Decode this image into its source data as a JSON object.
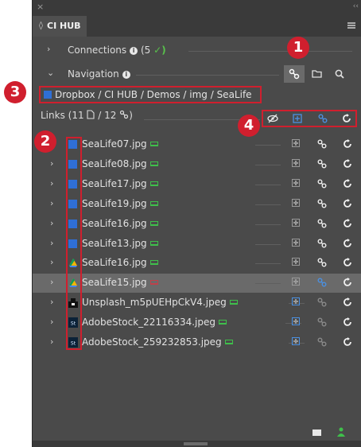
{
  "window": {
    "close_glyph": "×",
    "collapse_glyph": "‹‹"
  },
  "tab": {
    "label": "CI HUB",
    "icon": "ci-hub-icon"
  },
  "connections": {
    "label": "Connections",
    "count": "(5",
    "check": "✓)"
  },
  "navigation": {
    "label": "Navigation"
  },
  "path": {
    "text": "Dropbox / CI HUB / Demos / img / SeaLife"
  },
  "links": {
    "label": "Links (11",
    "sep": "/ 12"
  },
  "files": [
    {
      "name": "SeaLife07.jpg",
      "icon": "dropbox-icon",
      "status": "ok",
      "selected": false
    },
    {
      "name": "SeaLife08.jpg",
      "icon": "dropbox-icon",
      "status": "ok",
      "selected": false
    },
    {
      "name": "SeaLife17.jpg",
      "icon": "dropbox-icon",
      "status": "ok",
      "selected": false
    },
    {
      "name": "SeaLife19.jpg",
      "icon": "dropbox-icon",
      "status": "ok",
      "selected": false
    },
    {
      "name": "SeaLife16.jpg",
      "icon": "dropbox-icon",
      "status": "ok",
      "selected": false
    },
    {
      "name": "SeaLife13.jpg",
      "icon": "dropbox-icon",
      "status": "ok",
      "selected": false
    },
    {
      "name": "SeaLife16.jpg",
      "icon": "google-drive-icon",
      "status": "ok",
      "selected": false
    },
    {
      "name": "SeaLife15.jpg",
      "icon": "google-drive-icon",
      "status": "error",
      "selected": true
    },
    {
      "name": "Unsplash_m5pUEHpCkV4.jpeg",
      "icon": "unsplash-icon",
      "status": "ok",
      "selected": false
    },
    {
      "name": "AdobeStock_22116334.jpeg",
      "icon": "adobe-stock-icon",
      "status": "ok",
      "selected": false
    },
    {
      "name": "AdobeStock_259232853.jpeg",
      "icon": "adobe-stock-icon",
      "status": "ok",
      "selected": false
    }
  ],
  "callouts": [
    "1",
    "2",
    "3",
    "4"
  ],
  "colors": {
    "accent_red": "#d01f2e",
    "dropbox_blue": "#2f6fd6",
    "ok_green": "#3fbf4b",
    "link_blue": "#4a90e2"
  }
}
